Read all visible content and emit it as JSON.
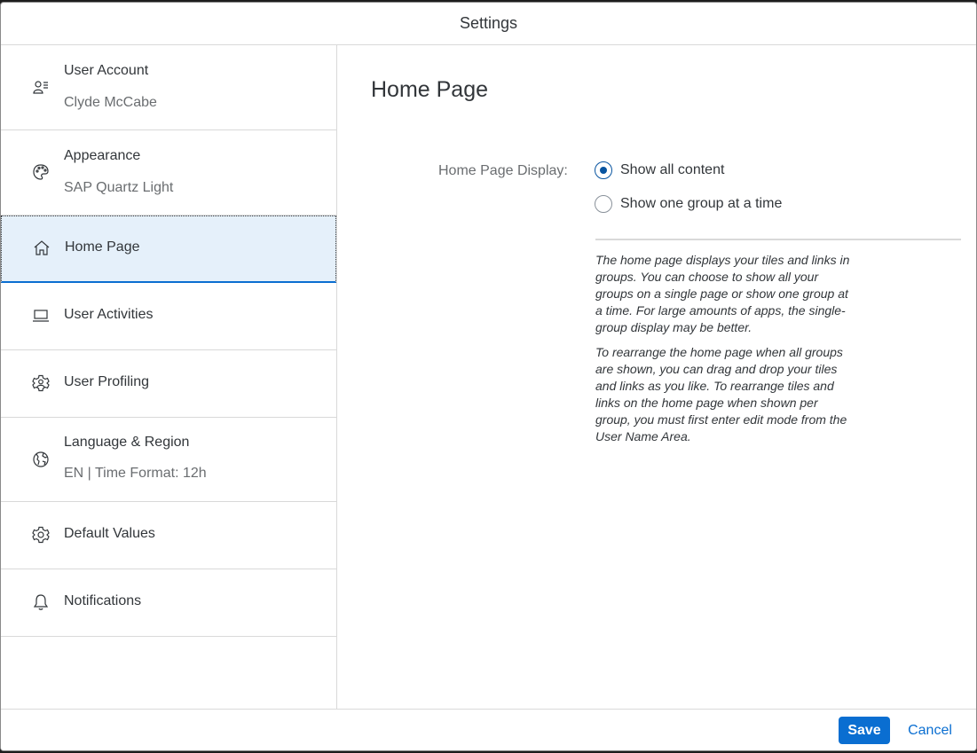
{
  "dialog": {
    "title": "Settings"
  },
  "sidebar": {
    "items": [
      {
        "title": "User Account",
        "subtitle": "Clyde McCabe",
        "icon": "user-account-icon"
      },
      {
        "title": "Appearance",
        "subtitle": "SAP Quartz Light",
        "icon": "palette-icon"
      },
      {
        "title": "Home Page",
        "icon": "home-icon",
        "selected": true
      },
      {
        "title": "User Activities",
        "icon": "laptop-icon"
      },
      {
        "title": "User Profiling",
        "icon": "user-settings-icon"
      },
      {
        "title": "Language & Region",
        "subtitle": "EN | Time Format: 12h",
        "icon": "globe-icon"
      },
      {
        "title": "Default Values",
        "icon": "gear-icon"
      },
      {
        "title": "Notifications",
        "icon": "bell-icon"
      }
    ]
  },
  "main": {
    "title": "Home Page",
    "display_label": "Home Page Display:",
    "options": [
      {
        "label": "Show all content",
        "selected": true
      },
      {
        "label": "Show one group at a time",
        "selected": false
      }
    ],
    "help": [
      "The home page displays your tiles and links in groups. You can choose to show all your groups on a single page or show one group at a time. For large amounts of apps, the single-group display may be better.",
      "To rearrange the home page when all groups are shown, you can drag and drop your tiles and links as you like. To rearrange tiles and links on the home page when shown per group, you must first enter edit mode from the User Name Area."
    ]
  },
  "footer": {
    "save_label": "Save",
    "cancel_label": "Cancel"
  },
  "colors": {
    "accent": "#0a6ed1",
    "selected_bg": "#e5f0fa",
    "text": "#32363a",
    "subtext": "#6a6d70"
  }
}
